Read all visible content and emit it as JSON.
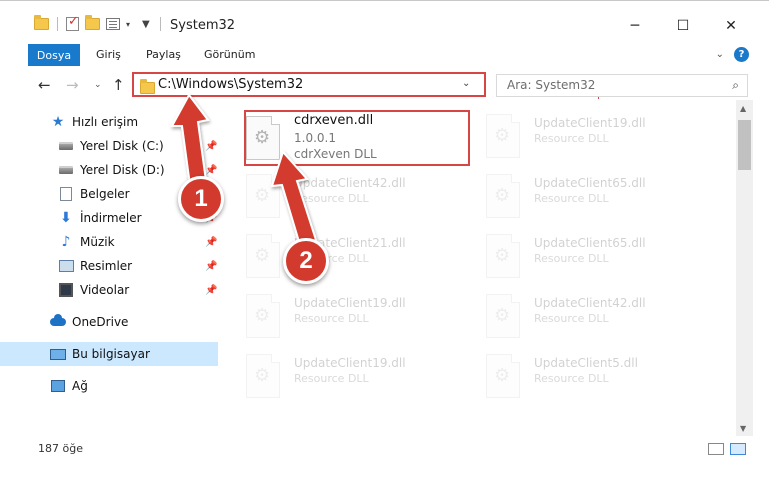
{
  "window": {
    "title": "System32",
    "minimize": "─",
    "maximize": "☐",
    "close": "✕"
  },
  "ribbon": {
    "tabs": [
      "Dosya",
      "Giriş",
      "Paylaş",
      "Görünüm"
    ]
  },
  "address": {
    "path": "C:\\Windows\\System32",
    "search_placeholder": "Ara: System32"
  },
  "sidebar": {
    "quick_access": "Hızlı erişim",
    "items": [
      {
        "label": "Yerel Disk (C:)",
        "icon": "disk-icon",
        "pinned": true
      },
      {
        "label": "Yerel Disk (D:)",
        "icon": "disk-icon",
        "pinned": true
      },
      {
        "label": "Belgeler",
        "icon": "document-icon",
        "pinned": true
      },
      {
        "label": "İndirmeler",
        "icon": "download-icon",
        "pinned": true
      },
      {
        "label": "Müzik",
        "icon": "music-icon",
        "pinned": true
      },
      {
        "label": "Resimler",
        "icon": "pictures-icon",
        "pinned": true
      },
      {
        "label": "Videolar",
        "icon": "video-icon",
        "pinned": true
      }
    ],
    "onedrive": "OneDrive",
    "this_pc": "Bu bilgisayar",
    "network": "Ağ"
  },
  "files": {
    "highlighted": {
      "name": "cdrxeven.dll",
      "version": "1.0.0.1",
      "desc": "cdrXeven DLL"
    },
    "items": [
      {
        "name": "UpdateClient19.dll",
        "desc": "Resource DLL"
      },
      {
        "name": "UpdateClient42.dll",
        "desc": "Resource DLL"
      },
      {
        "name": "UpdateClient65.dll",
        "desc": "Resource DLL"
      },
      {
        "name": "UpdateClient21.dll",
        "desc": "Resource DLL"
      },
      {
        "name": "UpdateClient65.dll",
        "desc": "Resource DLL"
      },
      {
        "name": "UpdateClient19.dll",
        "desc": "Resource DLL"
      },
      {
        "name": "UpdateClient42.dll",
        "desc": "Resource DLL"
      },
      {
        "name": "UpdateClient19.dll",
        "desc": "Resource DLL"
      },
      {
        "name": "UpdateClient5.dll",
        "desc": "Resource DLL"
      }
    ]
  },
  "status": {
    "count": "187 öğe"
  },
  "callouts": {
    "one": "1",
    "two": "2"
  },
  "colors": {
    "accent": "#1979ca",
    "highlight_border": "#d74545",
    "badge": "#d23a2e",
    "selection": "#cce8ff"
  }
}
